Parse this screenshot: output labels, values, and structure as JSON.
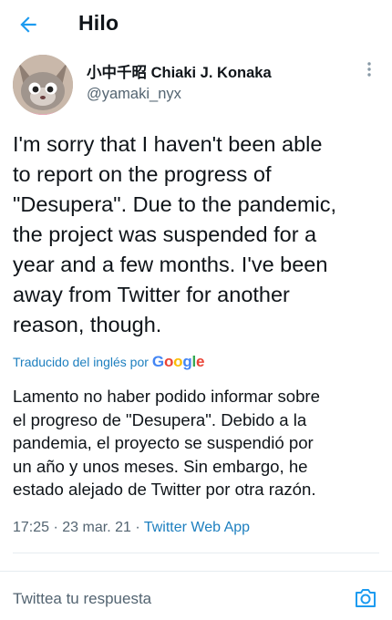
{
  "header": {
    "title": "Hilo",
    "back_icon": "arrow-left-icon"
  },
  "tweet": {
    "author_name": "小中千昭 Chiaki J. Konaka",
    "author_handle": "@yamaki_nyx",
    "text": "I'm sorry that I haven't been able\nto report on the progress of\n\"Desupera\". Due to the pandemic,\nthe project was suspended for a\nyear and a few months. I've been\naway from Twitter for another\nreason, though.",
    "translated_label": "Traducido del inglés por",
    "translation_provider": "Google",
    "translation": "Lamento no haber podido informar sobre\nel progreso de \"Desupera\". Debido a la\npandemia, el proyecto se suspendió por\nun año y unos meses. Sin embargo, he\nestado alejado de Twitter por otra razón.",
    "time": "17:25",
    "date": "23 mar. 21",
    "source": "Twitter Web App"
  },
  "reply": {
    "placeholder": "Twittea tu respuesta",
    "icon": "camera-icon"
  },
  "colors": {
    "accent": "#1d9bf0",
    "link": "#1d7fbf",
    "secondary_text": "#536471",
    "divider": "#e6ecf0"
  }
}
